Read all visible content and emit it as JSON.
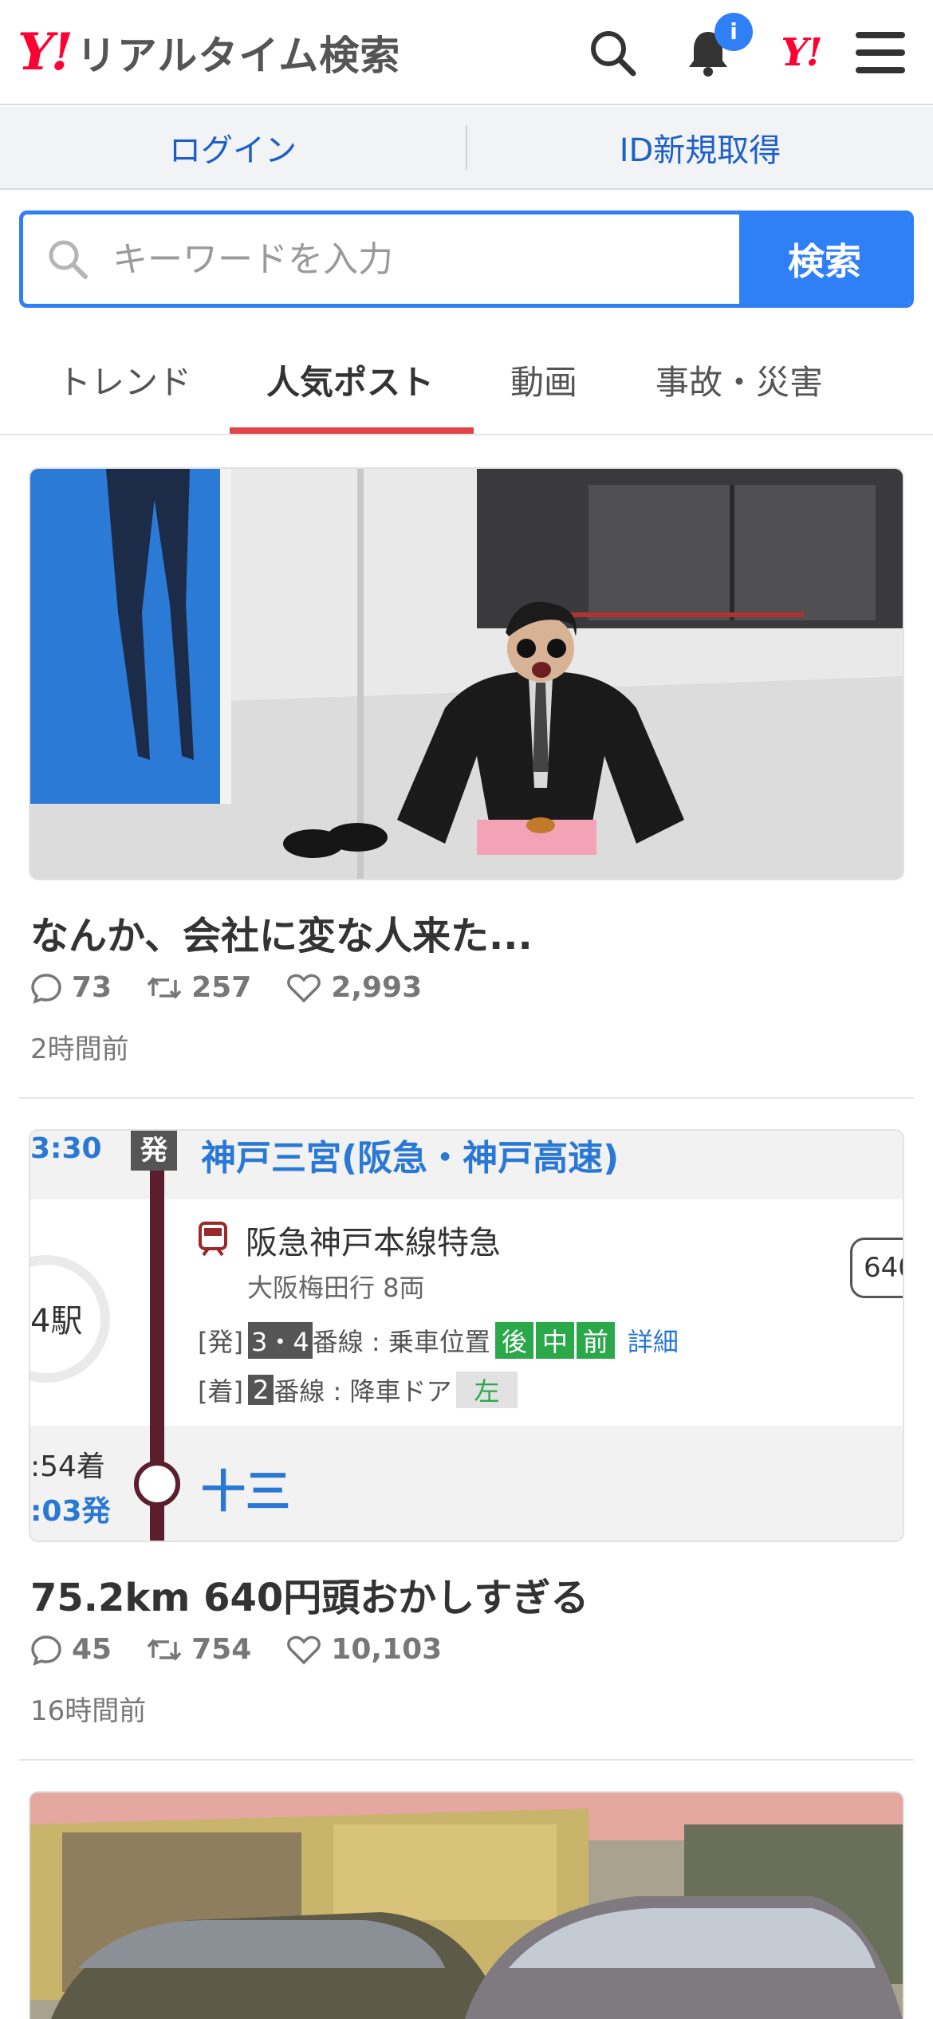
{
  "header": {
    "logo_mark": "Y!",
    "logo_text": "リアルタイム検索",
    "notification_badge": "i",
    "yjapan_mark": "Y!"
  },
  "login_bar": {
    "login": "ログイン",
    "register": "ID新規取得"
  },
  "search": {
    "placeholder": "キーワードを入力",
    "button": "検索"
  },
  "tabs": [
    {
      "label": "トレンド",
      "active": false
    },
    {
      "label": "人気ポスト",
      "active": true
    },
    {
      "label": "動画",
      "active": false
    },
    {
      "label": "事故・災害",
      "active": false
    }
  ],
  "posts": [
    {
      "title": "なんか、会社に変な人来た...",
      "replies": "73",
      "reposts": "257",
      "likes": "2,993",
      "time": "2時間前"
    },
    {
      "title": "75.2km 640円󠄀頭おかしすぎる",
      "replies": "45",
      "reposts": "754",
      "likes": "10,103",
      "time": "16時間前",
      "image": {
        "dep_time": "3:30",
        "dep_marker": "発",
        "dep_station": "神戸三宮(阪急・神戸高速)",
        "line_name": "阪急神戸本線特急",
        "line_dest": "大阪梅田行 8両",
        "dep_track_label": "[発]",
        "dep_track": "3・4",
        "dep_track_suffix": "番線 : 乗車位置",
        "pos_rear": "後",
        "pos_mid": "中",
        "pos_front": "前",
        "detail_link": "詳細",
        "arr_track_label": "[着]",
        "arr_track": "2",
        "arr_track_suffix": "番線 : 降車ドア",
        "door_side": "左",
        "fare_partial": "640",
        "stations_partial": "4駅",
        "arr_time": ":54着",
        "next_dep": ":03発",
        "arr_station": "十三"
      }
    }
  ],
  "colors": {
    "brand_red": "#ff0033",
    "accent_blue": "#2f7ff7",
    "tab_underline": "#e0434a",
    "link_blue": "#1d5fc9"
  }
}
